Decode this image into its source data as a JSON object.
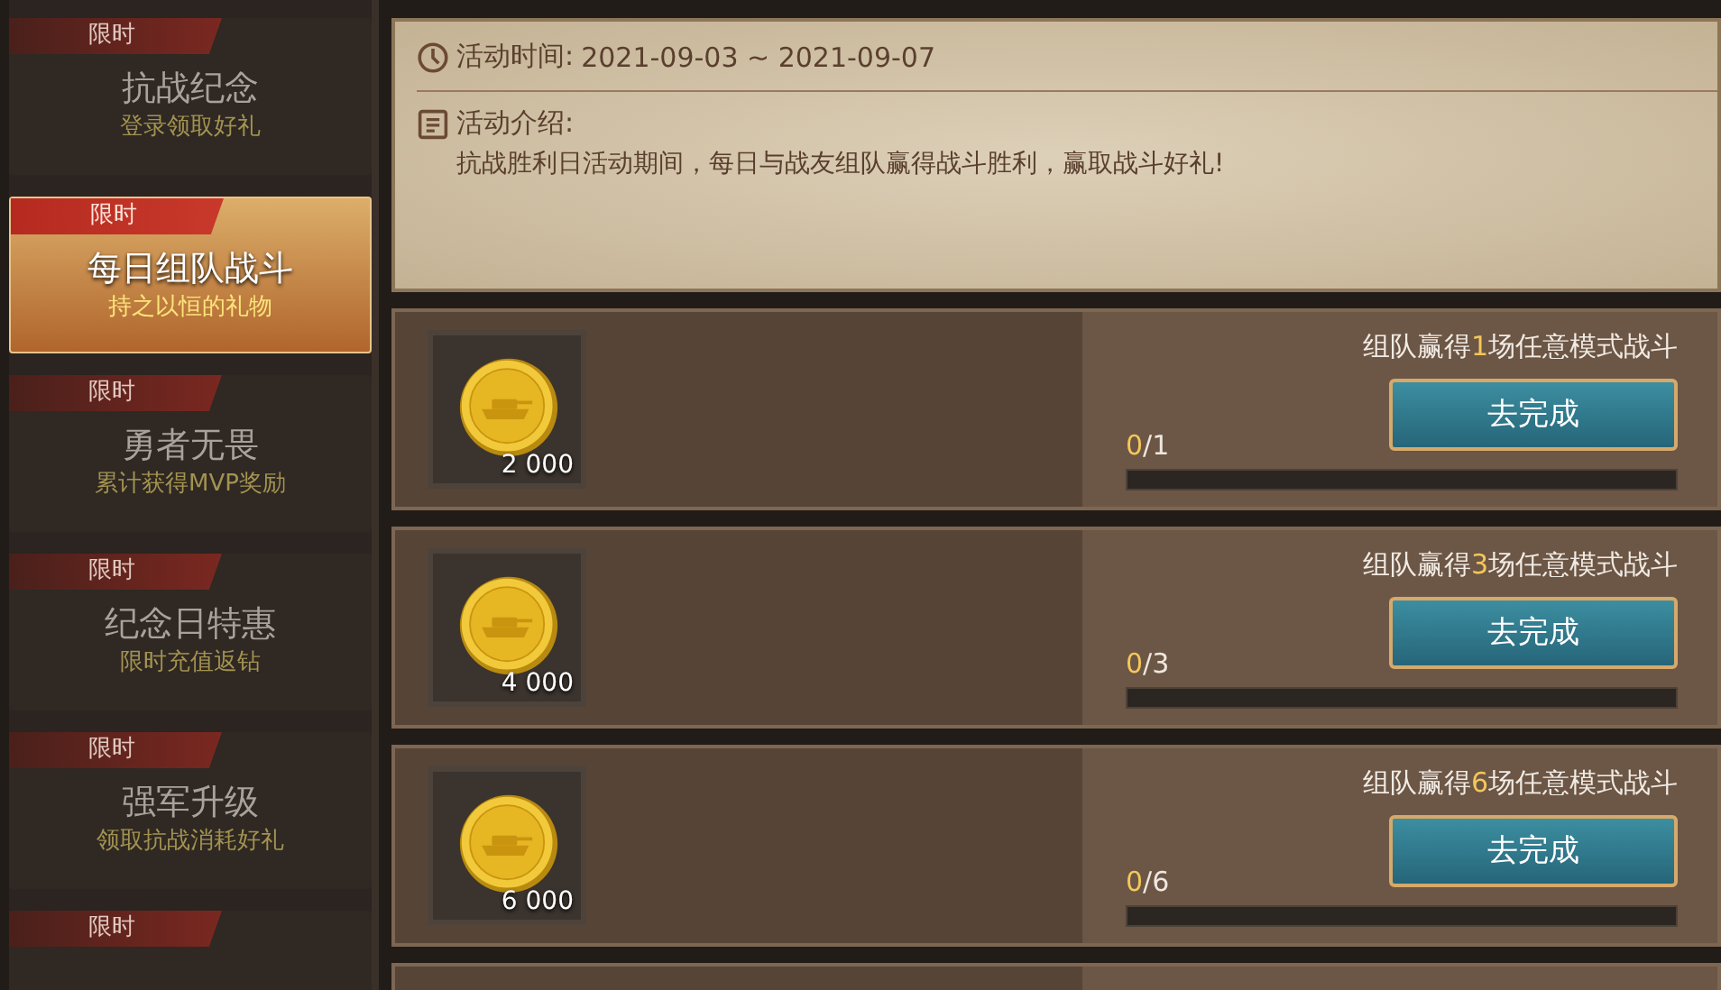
{
  "sidebar": {
    "items": [
      {
        "tag": "限时",
        "title": "抗战纪念",
        "subtitle": "登录领取好礼",
        "selected": false
      },
      {
        "tag": "限时",
        "title": "每日组队战斗",
        "subtitle": "持之以恒的礼物",
        "selected": true
      },
      {
        "tag": "限时",
        "title": "勇者无畏",
        "subtitle": "累计获得MVP奖励",
        "selected": false
      },
      {
        "tag": "限时",
        "title": "纪念日特惠",
        "subtitle": "限时充值返钻",
        "selected": false
      },
      {
        "tag": "限时",
        "title": "强军升级",
        "subtitle": "领取抗战消耗好礼",
        "selected": false
      },
      {
        "tag": "限时",
        "selected": false
      }
    ]
  },
  "info": {
    "time_label": "活动时间:",
    "time_value": "2021-09-03 ~ 2021-09-07",
    "intro_label": "活动介绍:",
    "intro_text": "抗战胜利日活动期间，每日与战友组队赢得战斗胜利，赢取战斗好礼!"
  },
  "quests": [
    {
      "reward": "2 000",
      "task_before": "组队赢得",
      "task_count": "1",
      "task_after": "场任意模式战斗",
      "button": "去完成",
      "progress_current": "0",
      "progress_total": "/1",
      "level": 0
    },
    {
      "reward": "4 000",
      "task_before": "组队赢得",
      "task_count": "3",
      "task_after": "场任意模式战斗",
      "button": "去完成",
      "progress_current": "0",
      "progress_total": "/3",
      "level": 0
    },
    {
      "reward": "6 000",
      "task_before": "组队赢得",
      "task_count": "6",
      "task_after": "场任意模式战斗",
      "button": "去完成",
      "progress_current": "0",
      "progress_total": "/6",
      "level": 0
    }
  ]
}
